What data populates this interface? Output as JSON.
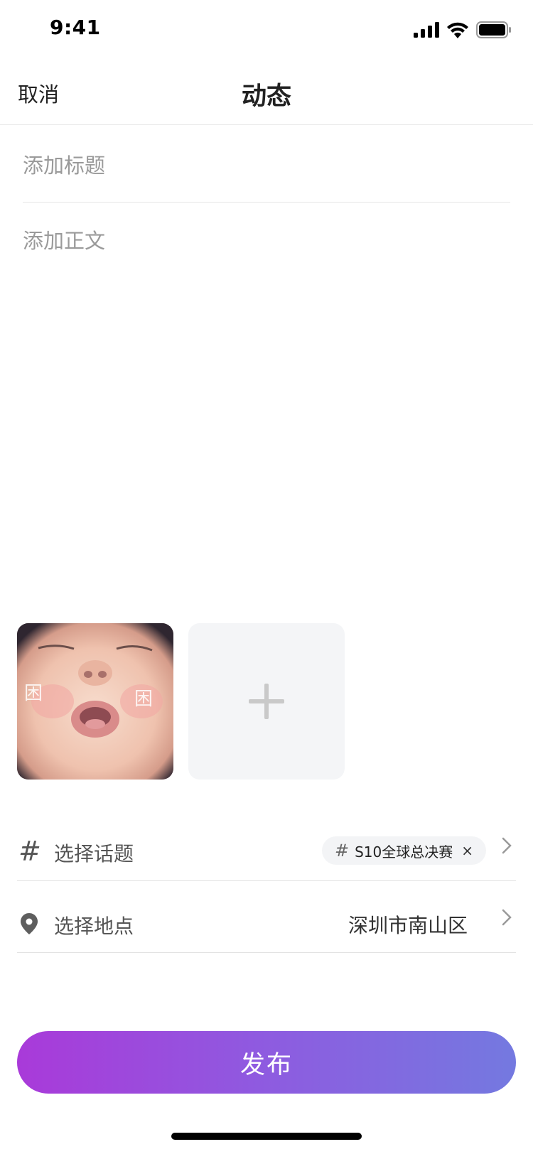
{
  "status_bar": {
    "time": "9:41"
  },
  "nav": {
    "cancel_label": "取消",
    "title": "动态"
  },
  "editor": {
    "title_placeholder": "添加标题",
    "body_placeholder": "添加正文"
  },
  "images": {
    "photo_stamp_text": "困",
    "add_icon": "plus-icon"
  },
  "topic_row": {
    "label": "选择话题",
    "icon": "hash-icon",
    "selected_topic": "S10全球总决赛",
    "chip_hash": "#",
    "chip_close": "×",
    "chevron": "›"
  },
  "location_row": {
    "label": "选择地点",
    "icon": "location-pin-icon",
    "value": "深圳市南山区",
    "chevron": "›"
  },
  "publish": {
    "label": "发布"
  },
  "colors": {
    "publish_gradient_start": "#a93ad9",
    "publish_gradient_end": "#7479e0",
    "placeholder": "#9a9a9a"
  }
}
